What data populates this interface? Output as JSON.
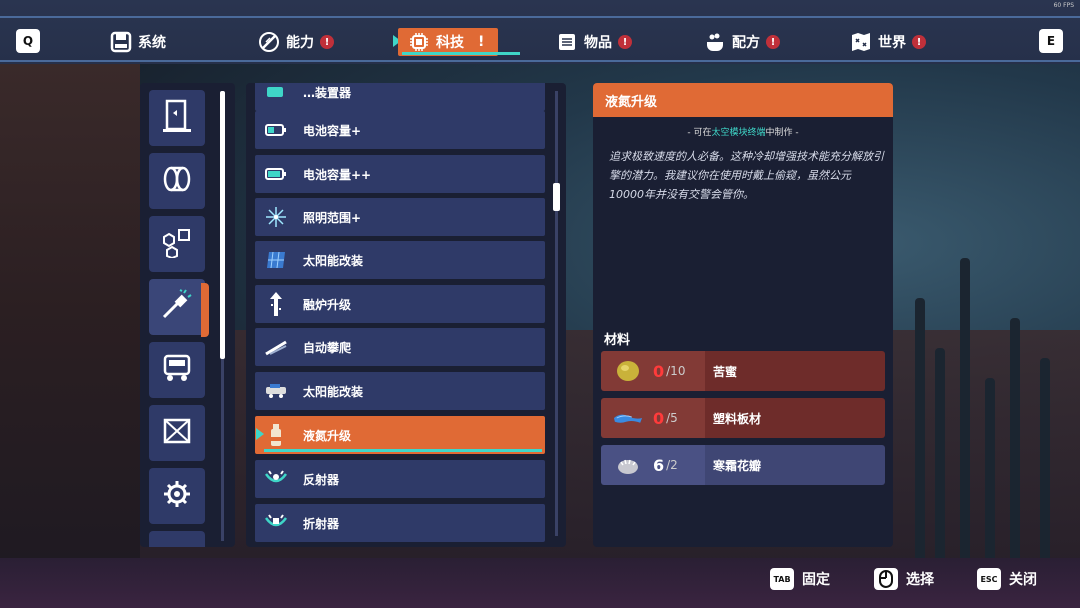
{
  "fps": "60 FPS",
  "topbar": {
    "left_key": "Q",
    "right_key": "E",
    "tabs": [
      {
        "label": "系统",
        "icon": "save-disk-icon",
        "alert": ""
      },
      {
        "label": "能力",
        "icon": "ability-icon",
        "alert": "!"
      },
      {
        "label": "科技",
        "icon": "chip-icon",
        "alert": "!"
      },
      {
        "label": "物品",
        "icon": "items-list-icon",
        "alert": "!"
      },
      {
        "label": "配方",
        "icon": "recipe-pot-icon",
        "alert": "!"
      },
      {
        "label": "世界",
        "icon": "world-map-icon",
        "alert": "!"
      }
    ],
    "active_tab": "科技"
  },
  "categories": [
    {
      "icon": "door-panel-icon"
    },
    {
      "icon": "coil-icon"
    },
    {
      "icon": "hex-chip-icon"
    },
    {
      "icon": "upgrade-tool-icon"
    },
    {
      "icon": "rover-vehicle-icon"
    },
    {
      "icon": "frame-structure-icon"
    },
    {
      "icon": "gear-cog-icon"
    }
  ],
  "items": [
    {
      "label": "…装置器",
      "icon": "battery-icon"
    },
    {
      "label": "电池容量+",
      "icon": "battery-icon"
    },
    {
      "label": "电池容量++",
      "icon": "battery-icon"
    },
    {
      "label": "照明范围+",
      "icon": "light-burst-icon"
    },
    {
      "label": "太阳能改装",
      "icon": "solar-panel-icon"
    },
    {
      "label": "融炉升级",
      "icon": "furnace-arrow-icon"
    },
    {
      "label": "自动攀爬",
      "icon": "climb-ramp-icon"
    },
    {
      "label": "太阳能改装",
      "icon": "solar-rover-icon"
    },
    {
      "label": "液氮升级",
      "icon": "nitrogen-canister-icon"
    },
    {
      "label": "反射器",
      "icon": "reflector-icon"
    },
    {
      "label": "折射器",
      "icon": "refractor-icon"
    }
  ],
  "detail": {
    "title": "液氮升级",
    "craft_prefix": "- 可在",
    "craft_station": "太空模块终端",
    "craft_suffix": "中制作 -",
    "description": "追求极致速度的人必备。这种冷却增强技术能充分解放引擎的潜力。我建议你在使用时戴上偷窥，虽然公元10000年并没有交警会管你。",
    "materials_heading": "材料",
    "materials": [
      {
        "name": "苦蜜",
        "have": "0",
        "need": "/10",
        "status": "short",
        "icon": "honey-orb-icon"
      },
      {
        "name": "塑料板材",
        "have": "0",
        "need": "/5",
        "status": "short",
        "icon": "plastic-sheet-icon"
      },
      {
        "name": "寒霜花瓣",
        "have": "6",
        "need": "/2",
        "status": "ok",
        "icon": "frost-petal-icon"
      }
    ]
  },
  "hints": [
    {
      "key": "TAB",
      "label": "固定",
      "icon": ""
    },
    {
      "key": "",
      "label": "选择",
      "icon": "mouse-icon"
    },
    {
      "key": "ESC",
      "label": "关闭",
      "icon": ""
    }
  ],
  "colors": {
    "accent": "#e06a35",
    "highlight": "#3fd6c8",
    "panel": "#1a1f33",
    "item": "#2f3a68",
    "alert": "#c0303a"
  }
}
